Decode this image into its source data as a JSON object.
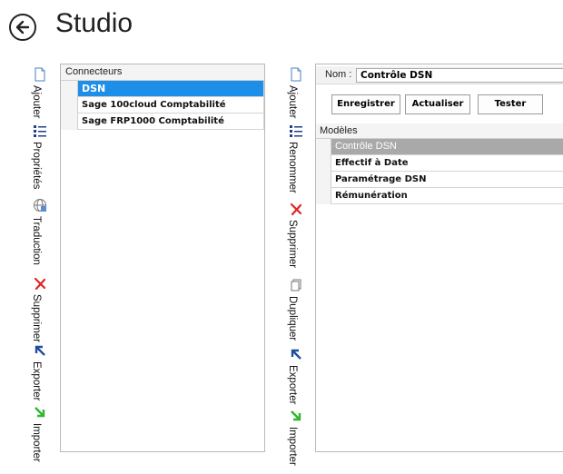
{
  "header": {
    "title": "Studio"
  },
  "left_toolbar": [
    {
      "label": "Ajouter",
      "icon": "page-icon"
    },
    {
      "label": "Propriétés",
      "icon": "list-icon"
    },
    {
      "label": "Traduction",
      "icon": "globe-icon"
    },
    {
      "label": "Supprimer",
      "icon": "delete-x-icon"
    },
    {
      "label": "Exporter",
      "icon": "export-arrow-icon"
    },
    {
      "label": "Importer",
      "icon": "import-arrow-icon"
    }
  ],
  "connectors": {
    "header": "Connecteurs",
    "rows": [
      "DSN",
      "Sage 100cloud Comptabilité",
      "Sage FRP1000 Comptabilité"
    ],
    "selected": "DSN"
  },
  "right_toolbar": [
    {
      "label": "Ajouter",
      "icon": "page-icon"
    },
    {
      "label": "Renommer",
      "icon": "list-icon"
    },
    {
      "label": "Supprimer",
      "icon": "delete-x-icon"
    },
    {
      "label": "Dupliquer",
      "icon": "duplicate-icon"
    },
    {
      "label": "Exporter",
      "icon": "export-arrow-icon"
    },
    {
      "label": "Importer",
      "icon": "import-arrow-icon"
    }
  ],
  "detail": {
    "name_label": "Nom :",
    "name_value": "Contrôle DSN",
    "buttons": {
      "save": "Enregistrer",
      "refresh": "Actualiser",
      "test": "Tester"
    },
    "models_header": "Modèles",
    "models": [
      "Contrôle DSN",
      "Effectif à Date",
      "Paramétrage DSN",
      "Rémunération"
    ],
    "selected_model": "Contrôle DSN"
  },
  "colors": {
    "selection_blue": "#1e8fe8",
    "selection_gray": "#a9a9a9",
    "delete_red": "#e02424",
    "export_blue": "#1f4f9c",
    "import_green": "#2fb52f"
  }
}
